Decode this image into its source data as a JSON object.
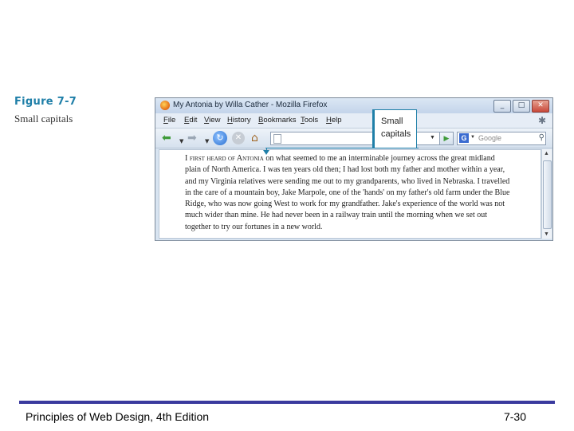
{
  "figure": {
    "label": "Figure 7-7",
    "caption": "Small capitals"
  },
  "browser": {
    "title": "My Antonia by Willa Cather - Mozilla Firefox",
    "window_buttons": [
      "_",
      "□",
      "✕"
    ],
    "menus": [
      {
        "underlined": "F",
        "rest": "ile"
      },
      {
        "underlined": "E",
        "rest": "dit"
      },
      {
        "underlined": "V",
        "rest": "iew"
      },
      {
        "underlined": "H",
        "rest": "istory"
      },
      {
        "underlined": "B",
        "rest": "ookmarks"
      },
      {
        "underlined": "T",
        "rest": "ools"
      },
      {
        "underlined": "H",
        "rest": "elp"
      }
    ],
    "search_placeholder": "Google",
    "paragraph": {
      "small_caps_lead": "I first heard of Antonia",
      "text": " on what seemed to me an interminable journey across the great midland plain of North America. I was ten years old then; I had lost both my father and mother within a year, and my Virginia relatives were sending me out to my grandparents, who lived in Nebraska. I travelled in the care of a mountain boy, Jake Marpole, one of the 'hands' on my father's old farm under the Blue Ridge, who was now going West to work for my grandfather. Jake's experience of the world was not much wider than mine. He had never been in a railway train until the morning when we set out together to try our fortunes in a new world."
    }
  },
  "callout": {
    "line1": "Small",
    "line2": "capitals"
  },
  "footer": {
    "left": "Principles of Web Design, 4th Edition",
    "right": "7-30"
  },
  "colors": {
    "accent": "#1f7fa8",
    "footer_rule": "#3a3a9e"
  }
}
